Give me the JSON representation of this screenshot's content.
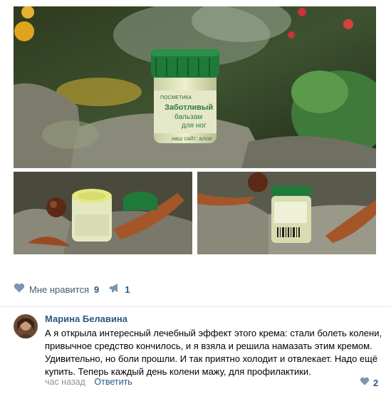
{
  "post": {
    "images": [
      {
        "alt": "main-photo"
      },
      {
        "alt": "thumb-1"
      },
      {
        "alt": "thumb-2"
      }
    ],
    "product_label": {
      "brand": "ПОСМЕТИКА",
      "line1": "Заботливый",
      "line2": "бальзам",
      "line3": "для ног",
      "site": "наш сайт: алое"
    },
    "actions": {
      "like_label": "Мне нравится",
      "like_count": "9",
      "share_count": "1"
    }
  },
  "comment": {
    "author": "Марина Белавина",
    "text": "А я открыла интересный лечебный эффект этого крема: стали болеть колени, привычное средство кончилось, и я взяла и решила намазать этим кремом. Удивительно, но боли прошли. И так приятно холодит и отвлекает. Надо ещё купить. Теперь каждый день колени мажу, для профилактики.",
    "time": "час назад",
    "reply_label": "Ответить",
    "like_count": "2"
  },
  "colors": {
    "link": "#2a5885",
    "icon": "#7c95b0",
    "muted": "#939393",
    "jar_green": "#1f7a3a"
  },
  "icons": {
    "like": "heart-icon",
    "share": "megaphone-icon",
    "comment_like": "heart-icon"
  }
}
